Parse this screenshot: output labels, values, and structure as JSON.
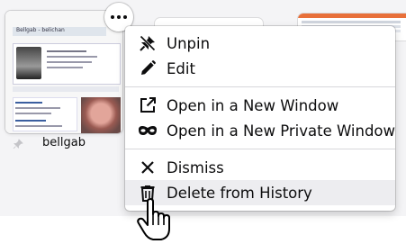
{
  "tile": {
    "label": "bellgab",
    "thumb_header": "Bellgab - belichan"
  },
  "menu": {
    "items": [
      {
        "label": "Unpin",
        "icon": "unpin-icon"
      },
      {
        "label": "Edit",
        "icon": "pencil-icon"
      },
      {
        "label": "Open in a New Window",
        "icon": "new-window-icon"
      },
      {
        "label": "Open in a New Private Window",
        "icon": "private-mask-icon"
      },
      {
        "label": "Dismiss",
        "icon": "close-icon"
      },
      {
        "label": "Delete from History",
        "icon": "trash-icon"
      }
    ]
  },
  "colors": {
    "menu_hover": "#ededf0",
    "text": "#0c0c0d",
    "separator": "#d7d7db"
  }
}
